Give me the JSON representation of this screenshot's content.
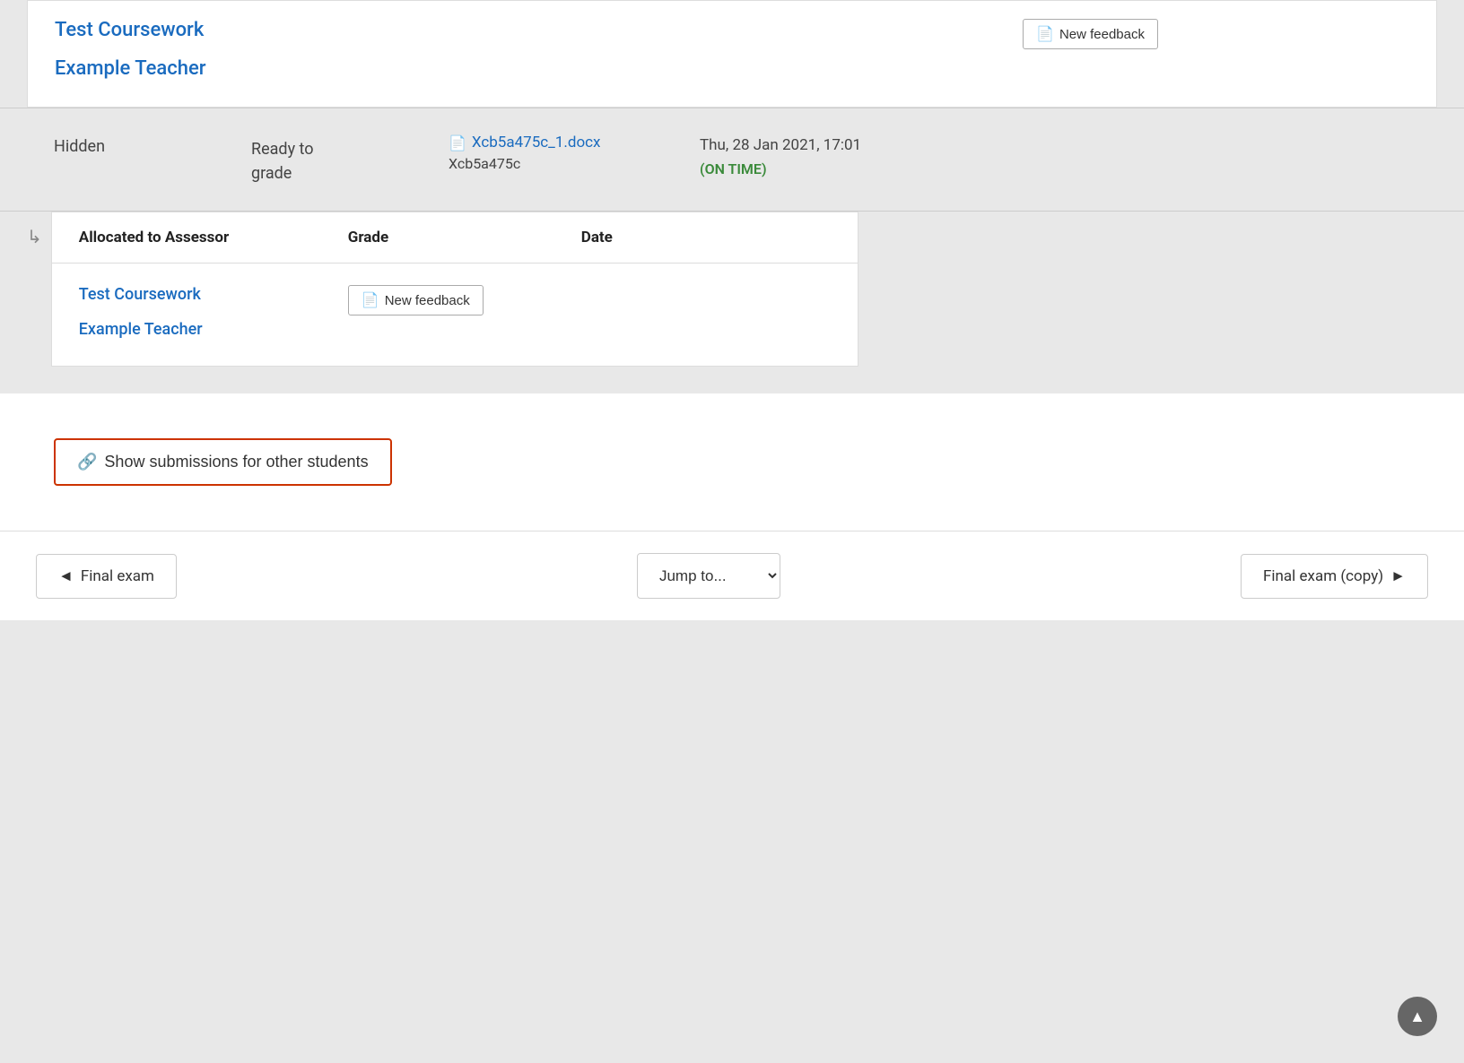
{
  "topCard": {
    "courseWorkLabel": "Test Coursework",
    "feedbackBtn": "New feedback",
    "teacherLabel": "Example Teacher"
  },
  "hiddenRow": {
    "statusLabel": "Hidden",
    "gradeStatus": "Ready to\ngrade",
    "fileName": "Xcb5a475c_1.docx",
    "fileId": "Xcb5a475c",
    "date": "Thu, 28 Jan 2021, 17:01",
    "onTime": "(ON TIME)"
  },
  "innerCard": {
    "headers": {
      "assessor": "Allocated to Assessor",
      "grade": "Grade",
      "date": "Date"
    },
    "row": {
      "courseWorkLabel": "Test Coursework",
      "feedbackBtn": "New feedback",
      "teacherLabel": "Example Teacher"
    }
  },
  "showSubmissionsBtn": "Show submissions for other students",
  "footer": {
    "prevLabel": "Final exam",
    "jumpLabel": "Jump to...",
    "nextLabel": "Final exam (copy)"
  },
  "icons": {
    "docIcon": "📄",
    "linkIcon": "🔗",
    "arrowLeft": "◄",
    "arrowRight": "►",
    "arrowCorner": "↳",
    "scrollTop": "▲"
  }
}
